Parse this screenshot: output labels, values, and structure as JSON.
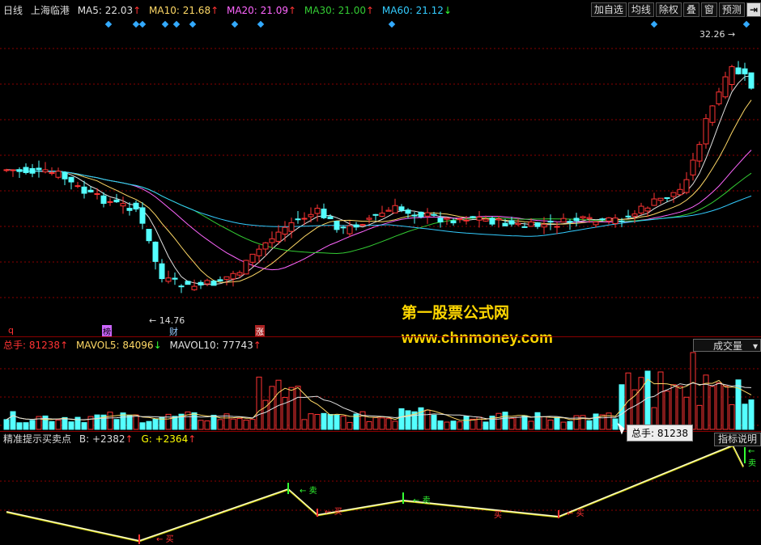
{
  "header": {
    "period": "日线",
    "stock_name": "上海临港",
    "ma5": {
      "label": "MA5:",
      "value": "22.03",
      "arrow": "↑",
      "color": "#e0e0e0"
    },
    "ma10": {
      "label": "MA10:",
      "value": "21.68",
      "arrow": "↑",
      "color": "#ffd966"
    },
    "ma20": {
      "label": "MA20:",
      "value": "21.09",
      "arrow": "↑",
      "color": "#ff66ff"
    },
    "ma30": {
      "label": "MA30:",
      "value": "21.00",
      "arrow": "↑",
      "color": "#33cc33"
    },
    "ma60": {
      "label": "MA60:",
      "value": "21.12",
      "arrow": "↓",
      "color": "#33ccff"
    }
  },
  "toolbar": {
    "add_watch": "加自选",
    "avg_line": "均线",
    "ex_right": "除权",
    "overlay": "叠",
    "window": "窗",
    "forecast": "预测",
    "exit_icon": "exit-arrow-icon"
  },
  "main": {
    "high_label": "32.26",
    "low_label": "14.76",
    "events": [
      "q",
      "榜",
      "财",
      "涨"
    ]
  },
  "watermark": {
    "line1": "第一股票公式网",
    "line2": "www.chnmoney.com"
  },
  "volume": {
    "total_label": "总手:",
    "total_value": "81238",
    "total_arrow": "↑",
    "mavol5_label": "MAVOL5:",
    "mavol5_value": "84096",
    "mavol5_arrow": "↓",
    "mavol10_label": "MAVOL10:",
    "mavol10_value": "77743",
    "mavol10_arrow": "↑",
    "dropdown_value": "成交量",
    "tooltip": "总手: 81238"
  },
  "indicator": {
    "name": "精准提示买卖点",
    "b_label": "B:",
    "b_value": "+2382",
    "b_arrow": "↑",
    "g_label": "G:",
    "g_value": "+2364",
    "g_arrow": "↑",
    "help_button": "指标说明",
    "signals": [
      "卖",
      "买",
      "卖",
      "买",
      "卖",
      "买",
      "买"
    ]
  },
  "colors": {
    "up": "#ff3333",
    "down": "#54ffff",
    "grid": "#8b0000",
    "bg": "#000000"
  }
}
